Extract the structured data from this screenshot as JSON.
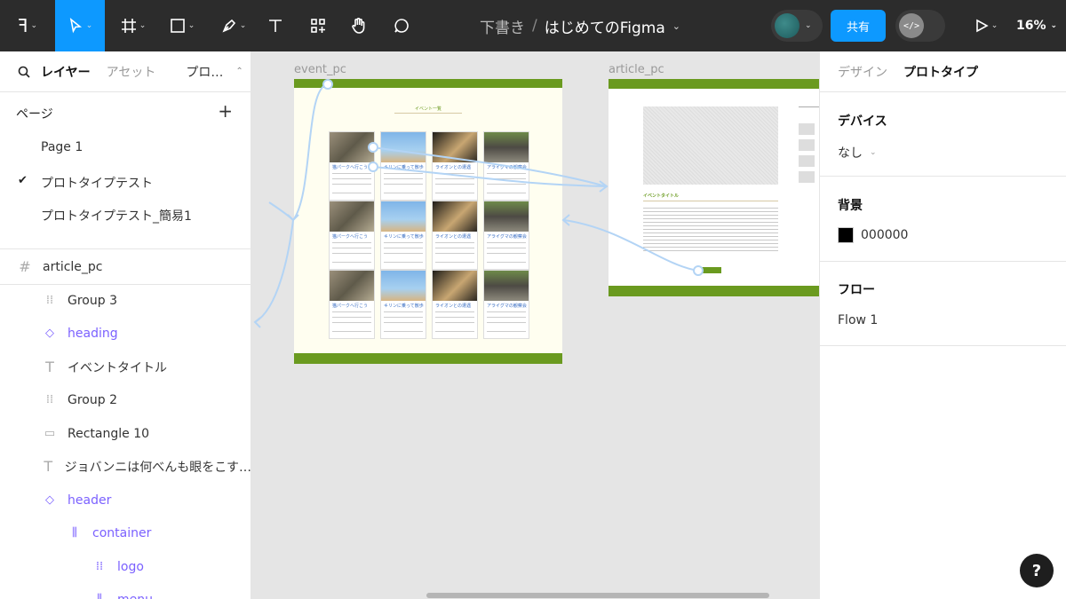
{
  "toolbar": {
    "title_prefix": "下書き",
    "title_separator": "/",
    "file_name": "はじめてのFigma",
    "share_label": "共有",
    "dev_mode_label": "</>",
    "zoom": "16%"
  },
  "left_panel": {
    "tabs": {
      "layers": "レイヤー",
      "assets": "アセット",
      "prototype": "プロ…"
    },
    "pages_heading": "ページ",
    "add_label": "+",
    "pages": [
      {
        "label": "Page 1",
        "selected": false
      },
      {
        "label": "プロトタイプテスト",
        "selected": true
      },
      {
        "label": "プロトタイプテスト_簡易1",
        "selected": false
      }
    ],
    "frame_name": "article_pc",
    "layers": [
      {
        "label": "Group 3",
        "icon": "group-icon",
        "component": false
      },
      {
        "label": "heading",
        "icon": "component-icon",
        "component": true
      },
      {
        "label": "イベントタイトル",
        "icon": "text-icon",
        "component": false
      },
      {
        "label": "Group 2",
        "icon": "group-icon",
        "component": false
      },
      {
        "label": "Rectangle 10",
        "icon": "rectangle-icon",
        "component": false
      },
      {
        "label": "ジョバンニは何べんも眼をこす…",
        "icon": "text-icon",
        "component": false
      },
      {
        "label": "header",
        "icon": "component-icon",
        "component": true
      },
      {
        "label": "container",
        "icon": "auto-layout-icon",
        "component": true
      },
      {
        "label": "logo",
        "icon": "group-icon",
        "component": true
      },
      {
        "label": "menu",
        "icon": "auto-layout-icon",
        "component": true
      }
    ]
  },
  "canvas": {
    "frame1_label": "event_pc",
    "frame2_label": "article_pc",
    "frame1_heading": "イベント一覧",
    "frame2_heading": "イベントタイトル",
    "card_titles": [
      "猫パークへ行こう",
      "キリンに乗って散歩",
      "ライオンとの遭遇",
      "アライグマの観察会"
    ],
    "colors": {
      "header_green": "#6a9a1f",
      "connector_blue": "#b3d4f5"
    }
  },
  "right_panel": {
    "tabs": {
      "design": "デザイン",
      "prototype": "プロトタイプ"
    },
    "device_heading": "デバイス",
    "device_value": "なし",
    "background_heading": "背景",
    "background_value": "000000",
    "flow_heading": "フロー",
    "flow_value": "Flow 1"
  },
  "help_label": "?"
}
